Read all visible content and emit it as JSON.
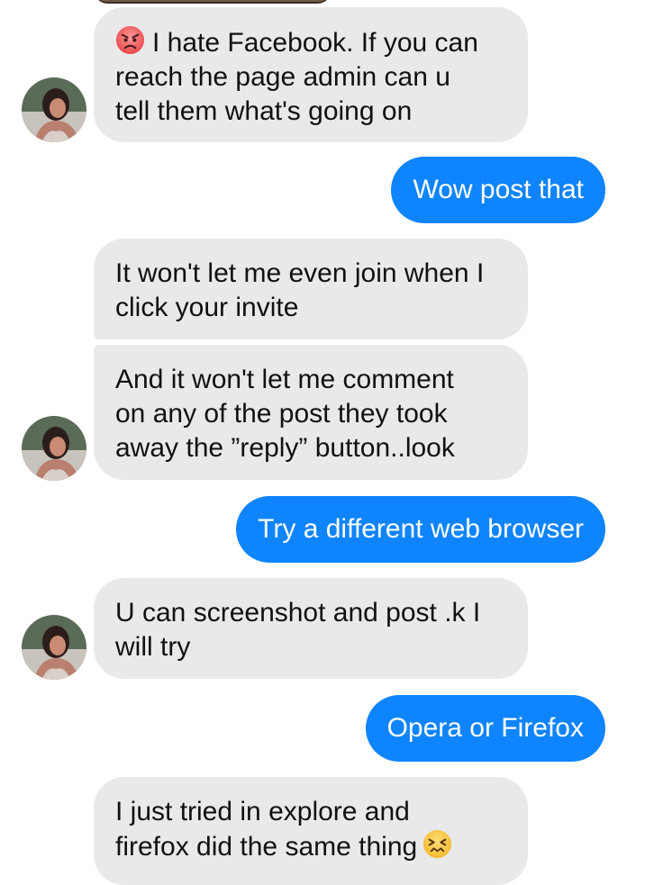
{
  "conversation": {
    "messages": [
      {
        "sender": "contact",
        "emoji_before": "angry-face",
        "text": "I hate Facebook. If you can\nreach the page admin can u\ntell them what's going on"
      },
      {
        "sender": "me",
        "text": "Wow post that"
      },
      {
        "sender": "contact",
        "text": "It won't let me even join when I\nclick your invite"
      },
      {
        "sender": "contact",
        "text": "And it won't let me comment\non any of the post they took\naway the ”reply” button..look"
      },
      {
        "sender": "me",
        "text": "Try a different web browser"
      },
      {
        "sender": "contact",
        "text": "U can screenshot and post .k I\nwill try"
      },
      {
        "sender": "me",
        "text": "Opera or Firefox"
      },
      {
        "sender": "contact",
        "emoji_after": "confounded-face",
        "text": "I just tried in explore and\nfirefox did the same thing"
      }
    ]
  },
  "colors": {
    "incoming_bubble": "#e9e9ea",
    "outgoing_bubble": "#0f84ff",
    "incoming_text": "#111111",
    "outgoing_text": "#ffffff"
  }
}
